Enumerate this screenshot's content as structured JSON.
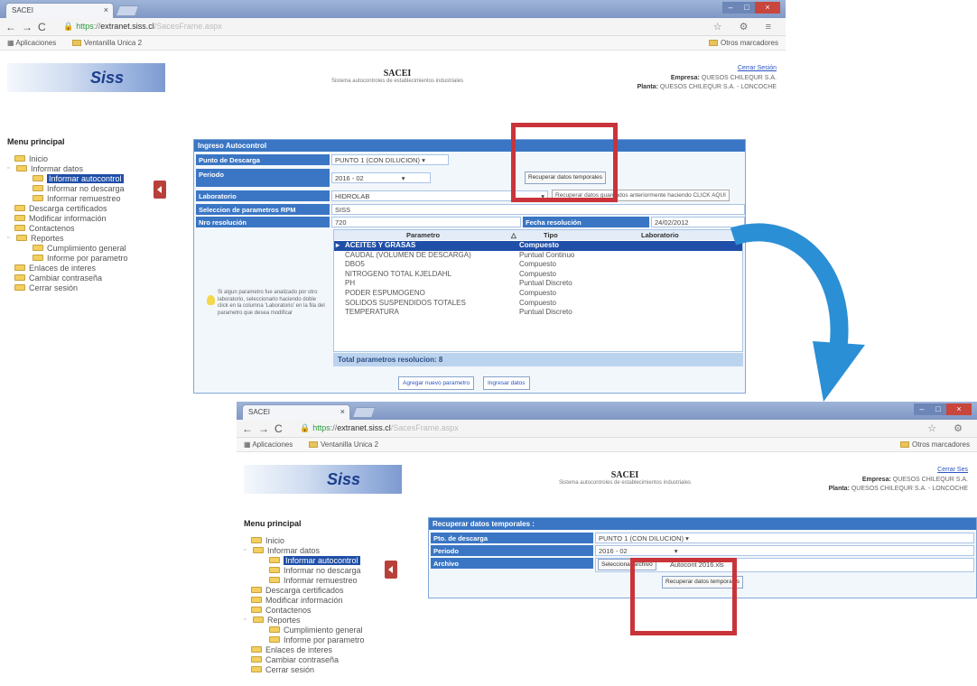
{
  "top": {
    "tab_title": "SACEI",
    "url_https": "https",
    "url_host": "extranet.siss.cl",
    "url_path": "/SacesFrame.aspx",
    "bookmark_apps": "Aplicaciones",
    "bookmark_item": "Ventanilla Unica 2",
    "bookmark_other": "Otros marcadores",
    "logo": "Siss",
    "site_title": "SACEI",
    "site_subtitle": "Sistema autocontroles de establecimientos industriales",
    "cerrar": "Cerrar Sesión",
    "empresa_label": "Empresa:",
    "empresa_value": "QUESOS CHILEQUR S.A.",
    "planta_label": "Planta:",
    "planta_value": "QUESOS CHILEQUR S.A. - LONCOCHE",
    "menu": {
      "title": "Menu principal",
      "items": [
        "Inicio",
        "Informar datos",
        "Informar autocontrol",
        "Informar no descarga",
        "Informar remuestreo",
        "Descarga certificados",
        "Modificar información",
        "Contactenos",
        "Reportes",
        "Cumplimiento general",
        "Informe por parametro",
        "Enlaces de interes",
        "Cambiar contraseña",
        "Cerrar sesión"
      ]
    },
    "panel": {
      "title": "Ingreso Autocontrol",
      "punto_label": "Punto de Descarga",
      "punto_value": "PUNTO 1 (CON DILUCION)",
      "periodo_label": "Periodo",
      "periodo_value": "2016 - 02",
      "recuperar_btn": "Recuperar datos temporales",
      "lab_label": "Laboratorio",
      "lab_value": "HIDROLAB",
      "tooltip": "Recuperar datos guardados anteriormente haciendo CLICK AQUI",
      "sel_param_label": "Seleccion de parametros RPM",
      "sel_param_value": "SISS",
      "nro_label": "Nro resolución",
      "nro_value": "720",
      "fecha_label": "Fecha resolución",
      "fecha_value": "24/02/2012",
      "col_parametro": "Parametro",
      "col_tipo": "Tipo",
      "col_lab": "Laboratorio",
      "rows": [
        {
          "p": "ACEITES Y GRASAS",
          "t": "Compuesto"
        },
        {
          "p": "CAUDAL (VOLUMEN DE DESCARGA)",
          "t": "Puntual Continuo"
        },
        {
          "p": "DBO5",
          "t": "Compuesto"
        },
        {
          "p": "NITROGENO TOTAL KJELDAHL",
          "t": "Compuesto"
        },
        {
          "p": "PH",
          "t": "Puntual Discreto"
        },
        {
          "p": "PODER ESPUMOGENO",
          "t": "Compuesto"
        },
        {
          "p": "SOLIDOS SUSPENDIDOS TOTALES",
          "t": "Compuesto"
        },
        {
          "p": "TEMPERATURA",
          "t": "Puntual Discreto"
        }
      ],
      "tip": "Si algun parametro fue analizado por otro laboratorio, seleccionarlo haciendo doble click en la columna 'Laboratorio' en la fila del parametro que desea modificar",
      "total": "Total parametros resolucion: 8",
      "btn_agregar": "Agregar nuevo parametro",
      "btn_ingresar": "Ingresar datos"
    }
  },
  "bottom": {
    "tab_title": "SACEI",
    "url_https": "https",
    "url_host": "extranet.siss.cl",
    "url_path": "/SacesFrame.aspx",
    "bookmark_apps": "Aplicaciones",
    "bookmark_item": "Ventanilla Unica 2",
    "bookmark_other": "Otros marcadores",
    "logo": "Siss",
    "site_title": "SACEI",
    "site_subtitle": "Sistema autocontroles de establecimientos industriales",
    "cerrar": "Cerrar Ses",
    "empresa_label": "Empresa:",
    "empresa_value": "QUESOS CHILEQUR S.A.",
    "planta_label": "Planta:",
    "planta_value": "QUESOS CHILEQUR S.A. - LONCOCHE",
    "menu": {
      "title": "Menu principal",
      "items": [
        "Inicio",
        "Informar datos",
        "Informar autocontrol",
        "Informar no descarga",
        "Informar remuestreo",
        "Descarga certificados",
        "Modificar información",
        "Contactenos",
        "Reportes",
        "Cumplimiento general",
        "Informe por parametro",
        "Enlaces de interes",
        "Cambiar contraseña",
        "Cerrar sesión"
      ]
    },
    "panel": {
      "title": "Recuperar datos temporales :",
      "punto_label": "Pto. de descarga",
      "punto_value": "PUNTO 1 (CON DILUCION)",
      "periodo_label": "Periodo",
      "periodo_value": "2016 - 02",
      "archivo_label": "Archivo",
      "select_file_btn": "Seleccionar archivo",
      "file_name": "Autocont  2016.xls",
      "recuperar_btn": "Recuperar datos temporales"
    }
  },
  "colors": {
    "accent": "#3a76c4",
    "highlight": "#c9343a",
    "arrow": "#2b8fd6"
  }
}
